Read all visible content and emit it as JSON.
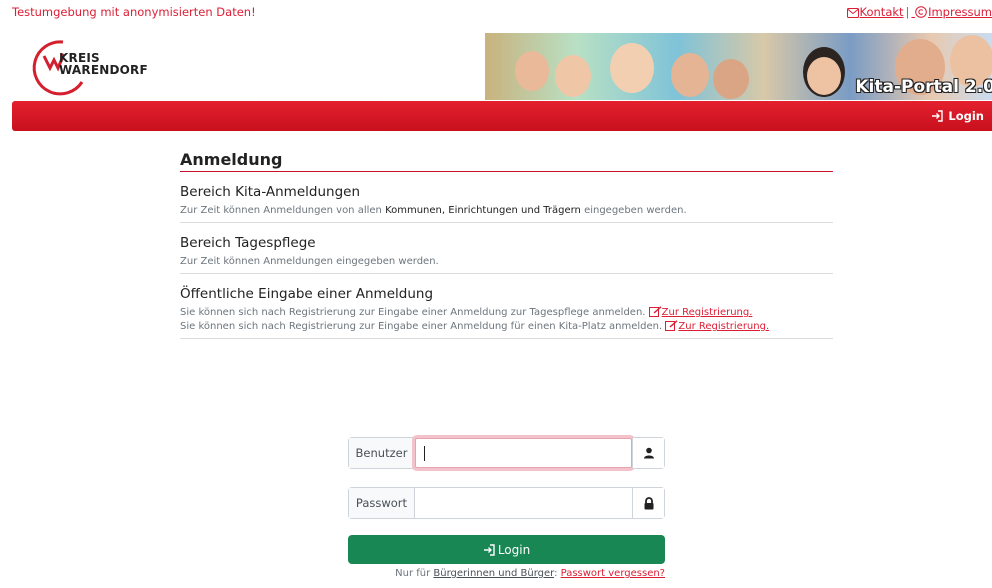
{
  "header": {
    "env_notice": "Testumgebung mit anonymisierten Daten!",
    "links": {
      "contact": "Kontakt",
      "separator": "|",
      "imprint": "Impressum"
    },
    "logo_text_1": "KREIS",
    "logo_text_2": "WARENDORF",
    "banner_title": "Kita-Portal 2.0"
  },
  "navbar": {
    "login": "Login"
  },
  "main": {
    "title": "Anmeldung",
    "sections": [
      {
        "heading": "Bereich Kita-Anmeldungen",
        "text_pre": "Zur Zeit können Anmeldungen von allen",
        "text_bold": "Kommunen, Einrichtungen und Trägern",
        "text_post": "eingegeben werden."
      },
      {
        "heading": "Bereich Tagespflege",
        "text": "Zur Zeit können Anmeldungen eingegeben werden."
      },
      {
        "heading": "Öffentliche Eingabe einer Anmeldung",
        "line1": "Sie können sich nach Registrierung zur Eingabe einer Anmeldung zur Tagespflege anmelden.",
        "line1_link": "Zur Registrierung.",
        "line2": "Sie können sich nach Registrierung zur Eingabe einer Anmeldung für einen Kita-Platz anmelden.",
        "line2_link": "Zur Registrierung."
      }
    ]
  },
  "form": {
    "user_label": "Benutzer",
    "user_value": "",
    "password_label": "Passwort",
    "password_value": "",
    "login_button": "Login",
    "forgot_prefix": "Nur für",
    "forgot_citizens": "Bürgerinnen und Bürger",
    "forgot_colon": ":",
    "forgot_link": "Passwort vergessen?"
  },
  "colors": {
    "brand_red": "#dc1e35",
    "login_green": "#198754"
  },
  "icons": [
    "envelope-icon",
    "copyright-icon",
    "login-icon",
    "user-icon",
    "lock-icon",
    "edit-icon"
  ]
}
